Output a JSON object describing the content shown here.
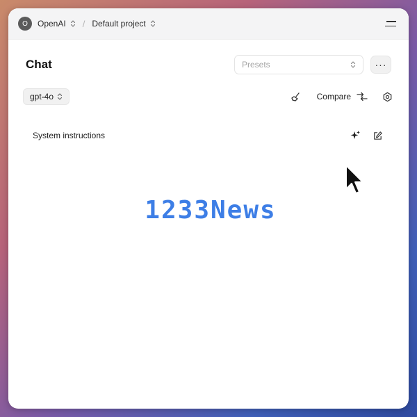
{
  "topbar": {
    "avatar_letter": "O",
    "org": "OpenAI",
    "project": "Default project"
  },
  "header": {
    "title": "Chat",
    "presets_placeholder": "Presets",
    "more_label": "···"
  },
  "toolbar": {
    "model": "gpt-4o",
    "compare_label": "Compare"
  },
  "system": {
    "label": "System instructions"
  },
  "watermark": "1233News",
  "colors": {
    "watermark": "#3d7ee6",
    "topbar_bg": "#f4f4f5"
  },
  "icons": [
    "chevron-updown-icon",
    "menu-icon",
    "more-icon",
    "clear-broom-icon",
    "compare-arrows-icon",
    "settings-gear-icon",
    "sparkle-icon",
    "edit-icon",
    "mouse-cursor-icon"
  ]
}
